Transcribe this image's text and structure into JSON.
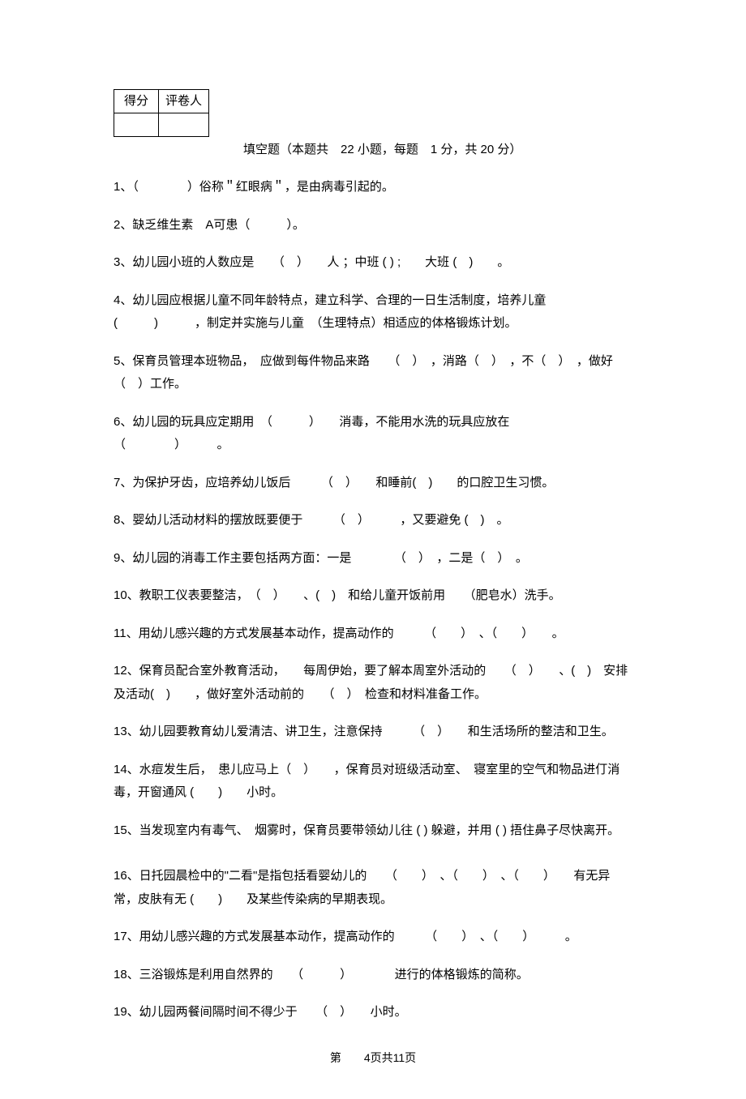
{
  "score_table": {
    "h1": "得分",
    "h2": "评卷人"
  },
  "section_title": "填空题（本题共　22 小题，每题　1 分，共 20 分）",
  "questions": {
    "q1": "1、（　　　　）俗称＂红眼病＂，是由病毒引起的。",
    "q2": "2、缺乏维生素　A可患（　　　）。",
    "q3": "3、幼儿园小班的人数应是　　（　）　　人 ；中班 ( ) ;　　大班 (　)　　。",
    "q4": "4、幼儿园应根据儿童不同年龄特点，建立科学、合理的一日生活制度，培养儿童(　　　)　　　，制定并实施与儿童　（生理特点）相适应的体格锻炼计划。",
    "q5": "5、保育员管理本班物品，　应做到每件物品来路　　（　）　，消路（　）　，不（　）　，做好（　）工作。",
    "q6": "6、幼儿园的玩具应定期用　（　　　）　　消毒，不能用水洗的玩具应放在　　　（　　　　）　　　。",
    "q7": "7、为保护牙齿，应培养幼儿饭后　　　（　）　　和睡前(　)　　的口腔卫生习惯。",
    "q8": "8、婴幼儿活动材料的摆放既要便于　　　（　）　　　，又要避免 (　)　。",
    "q9": "9、幼儿园的消毒工作主要包括两方面：一是　　　　（　）　，二是（　）　。",
    "q10": "10、教职工仪表要整洁，　（　）　　、(　)　和给儿童开饭前用　　（肥皂水）洗手。",
    "q11": "11、用幼儿感兴趣的方式发展基本动作，提高动作的　　　（　　）　、（　　）　　。",
    "q12": "12、保育员配合室外教育活动，　　每周伊始，要了解本周室外活动的　　（　）　　、(　)　安排及活动(　)　　，做好室外活动前的　　（　）　检查和材料准备工作。",
    "q13": "13、幼儿园要教育幼儿爱清洁、讲卫生，注意保持　　　（　）　　和生活场所的整洁和卫生。",
    "q14": "14、水痘发生后，　患儿应马上（　）　　，保育员对班级活动室、　寝室里的空气和物品进仃消毒，开窗通风 (　　)　　小时。",
    "q15": "15、当发现室内有毒气、　烟雾时，保育员要带领幼儿往 ( ) 躲避，并用 ( ) 捂住鼻子尽快离开。",
    "q16": "16、日托园晨检中的\"二看\"是指包括看婴幼儿的　　（　　）　、（　　）　、（　　）　　有无异常，皮肤有无 (　　)　　及某些传染病的早期表现。",
    "q17": "17、用幼儿感兴趣的方式发展基本动作，提高动作的　　　（　　）　、（　　）　　　。",
    "q18": "18、三浴锻炼是利用自然界的　　（　　　）　　　　进行的体格锻炼的简称。",
    "q19": "19、幼儿园两餐间隔时间不得少于　　（　）　　小时。"
  },
  "footer": {
    "prefix": "第",
    "page": "4页共11页"
  }
}
